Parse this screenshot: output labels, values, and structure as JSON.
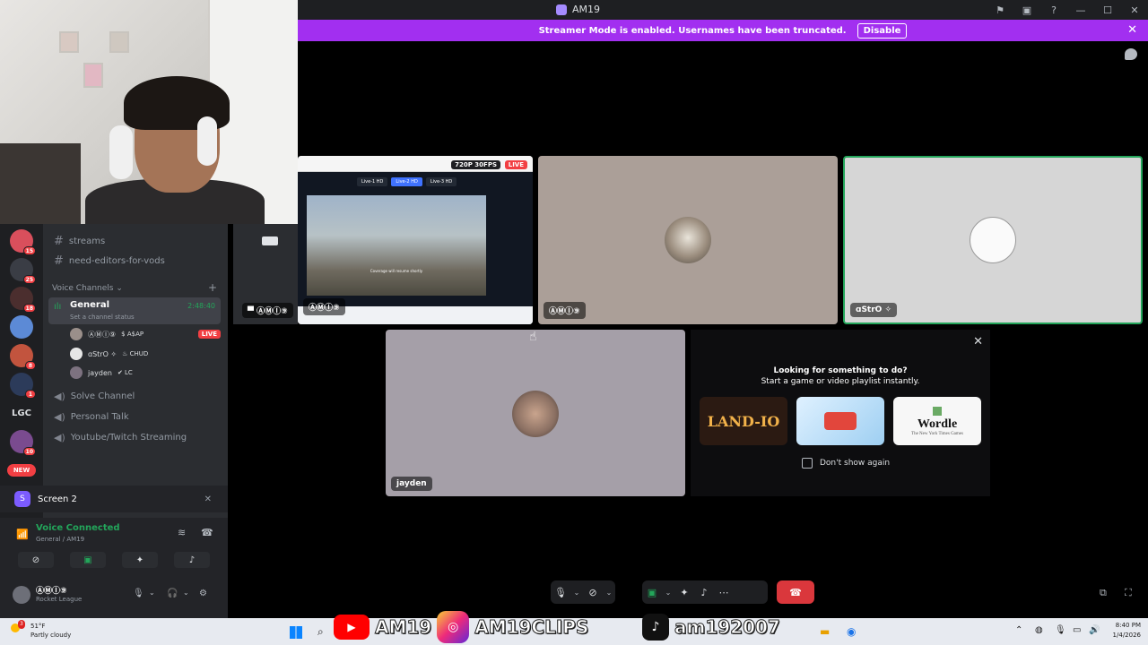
{
  "window": {
    "title": "AM19",
    "icons": [
      "flag-icon",
      "monitor-icon",
      "help-icon"
    ],
    "controls": [
      "minimize",
      "maximize",
      "close"
    ]
  },
  "banner": {
    "text": "Streamer Mode is enabled. Usernames have been truncated.",
    "button": "Disable",
    "accent": "#a22ff0"
  },
  "servers": {
    "items": [
      {
        "badge": "15"
      },
      {
        "badge": "25"
      },
      {
        "badge": "18"
      },
      {
        "badge": ""
      },
      {
        "badge": "8"
      },
      {
        "badge": "1"
      },
      {
        "label": "LGC"
      },
      {
        "badge": "10"
      }
    ],
    "new_label": "NEW"
  },
  "channels": {
    "text": [
      {
        "name": "streams"
      },
      {
        "name": "need-editors-for-vods"
      }
    ],
    "voice_header": "Voice Channels",
    "general": {
      "name": "General",
      "status": "Set a channel status",
      "time": "2:48:40"
    },
    "voice_users": [
      {
        "name": "ⒶⓂⒾ⑨",
        "tag": "$ A$AP",
        "live": "LIVE"
      },
      {
        "name": "ɑStrO ✧",
        "tag": "♨ CHUD",
        "live": ""
      },
      {
        "name": "jayden",
        "tag": "✔ LC",
        "live": ""
      }
    ],
    "voice_other": [
      {
        "name": "Solve Channel"
      },
      {
        "name": "Personal Talk"
      },
      {
        "name": "Youtube/Twitch Streaming"
      }
    ]
  },
  "screen_panel": {
    "label": "Screen 2"
  },
  "voice_panel": {
    "status": "Voice Connected",
    "location": "General / AM19"
  },
  "user_panel": {
    "name": "ⒶⓂⒾ⑨",
    "game": "Rocket League"
  },
  "tiles": {
    "stream": {
      "quality": "720P 30FPS",
      "live": "LIVE",
      "name": "ⒶⓂⒾ⑨",
      "tabs": [
        "Live-1 HD",
        "Live-2 HD",
        "Live-3 HD"
      ],
      "caption": "Coverage will resume shortly"
    },
    "preview": {
      "name": "ⒶⓂⒾ⑨"
    },
    "user2": {
      "name": "ⒶⓂⒾ⑨"
    },
    "user3": {
      "name": "ɑStrO ✧"
    },
    "user4": {
      "name": "jayden"
    }
  },
  "activity": {
    "heading": "Looking for something to do?",
    "subheading": "Start a game or video playlist instantly.",
    "cards": [
      {
        "title": "LAND-IO"
      },
      {
        "title": ""
      },
      {
        "title": "Wordle",
        "sub": "The New York Times Games"
      }
    ],
    "checkbox": "Don't show again"
  },
  "taskbar": {
    "weather_temp": "51°F",
    "weather_desc": "Partly cloudy",
    "social": {
      "youtube": "AM19",
      "instagram": "AM19CLIPS",
      "tiktok": "am192007"
    },
    "time": "8:40 PM",
    "date": "1/4/2026",
    "weather_badge": "3"
  }
}
